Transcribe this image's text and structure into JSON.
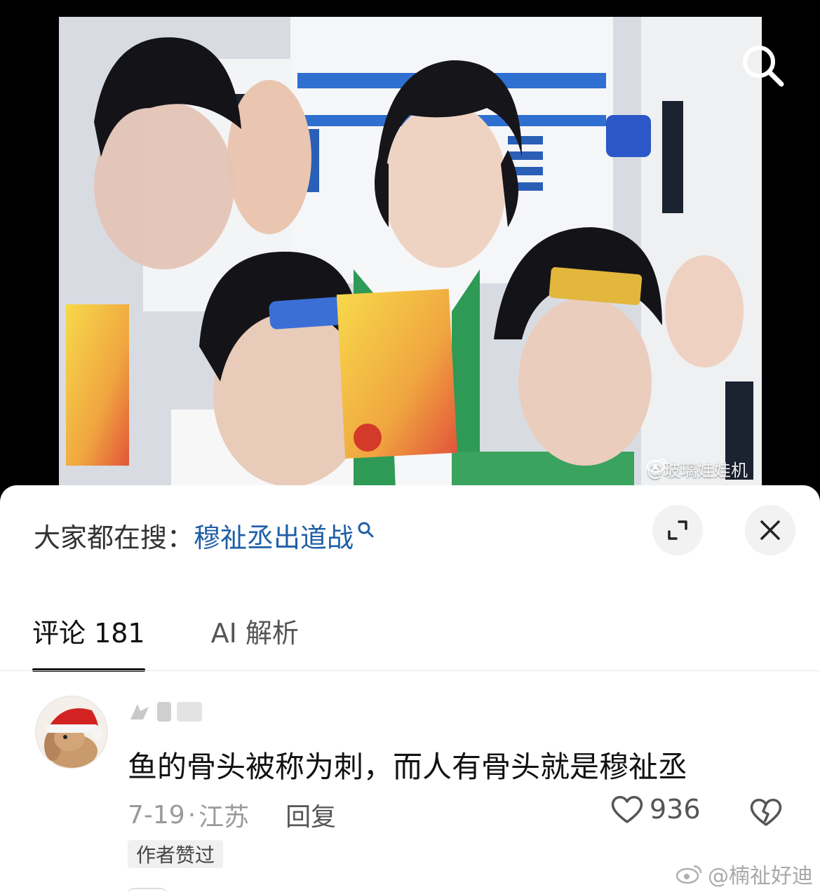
{
  "photo": {
    "watermark_text": "@玻璃娃娃机",
    "search_icon": "search-icon"
  },
  "search_bar": {
    "prefix": "大家都在搜：",
    "term": "穆祉丞出道战",
    "term_icon": "search-icon"
  },
  "controls": {
    "expand_icon": "expand-icon",
    "close_icon": "close-icon"
  },
  "tabs": [
    {
      "label": "评论 181",
      "active": true
    },
    {
      "label": "AI 解析",
      "active": false
    }
  ],
  "comment": {
    "text": "鱼的骨头被称为刺，而人有骨头就是穆祉丞",
    "date": "7-19",
    "location": "江苏",
    "separator": "·",
    "reply_label": "回复",
    "like_count": "936",
    "author_badge": "作者赞过",
    "avatar_icon": "rabbit-santa-hat-avatar"
  },
  "footer": {
    "watermark": "@楠祉好迪"
  }
}
